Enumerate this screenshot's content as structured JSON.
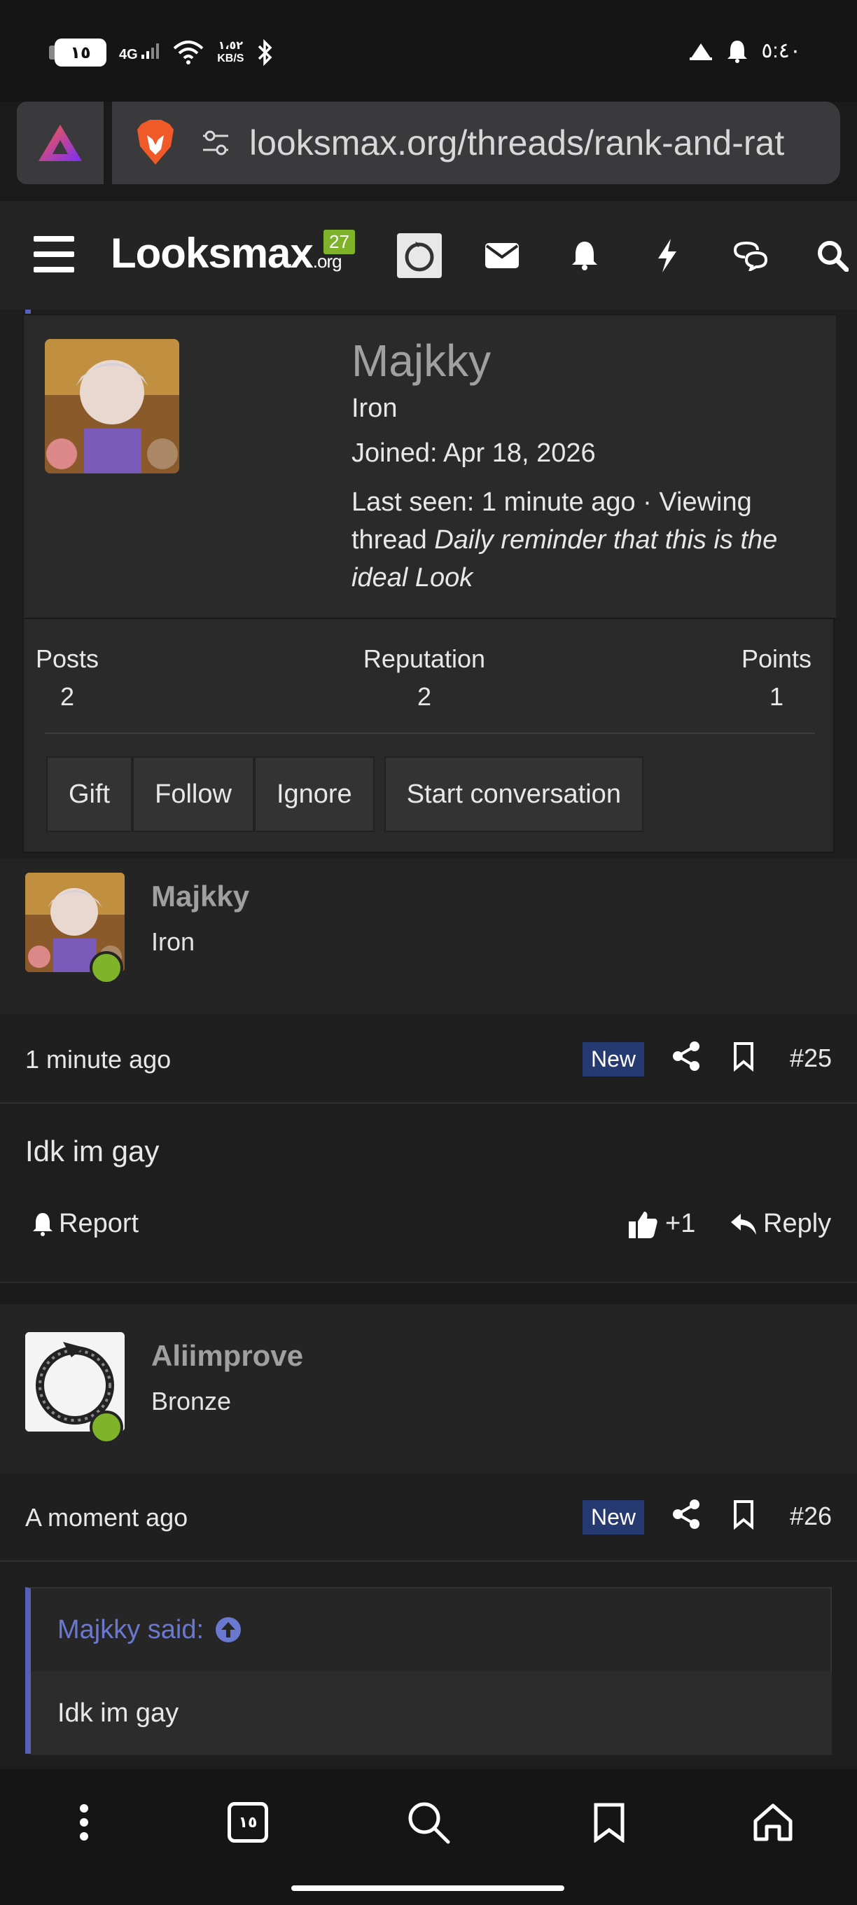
{
  "status_bar": {
    "battery": "١٥",
    "network": "4G",
    "speed_top": "١،٥٢",
    "speed_unit": "KB/S",
    "time": "٥:٤٠"
  },
  "browser": {
    "url": "looksmax.org/threads/rank-and-rat"
  },
  "site_header": {
    "logo_main": "Looksmax",
    "logo_suffix": ".org",
    "conversations_badge": "27"
  },
  "profile_popup": {
    "name": "Majkky",
    "rank": "Iron",
    "joined": "Joined: Apr 18, 2026",
    "last_seen_prefix": "Last seen: 1 minute ago · Viewing thread ",
    "last_seen_thread": "Daily reminder that this is the ideal Look",
    "stats": {
      "posts_label": "Posts",
      "posts_value": "2",
      "reputation_label": "Reputation",
      "reputation_value": "2",
      "points_label": "Points",
      "points_value": "1"
    },
    "actions": {
      "gift": "Gift",
      "follow": "Follow",
      "ignore": "Ignore",
      "start_conversation": "Start conversation"
    }
  },
  "posts": [
    {
      "username": "Majkky",
      "rank": "Iron",
      "time": "1 minute ago",
      "badge": "New",
      "number": "#25",
      "body": "Idk im gay",
      "report_label": "Report",
      "like_count": "+1",
      "reply_label": "Reply"
    },
    {
      "username": "Aliimprove",
      "rank": "Bronze",
      "time": "A moment ago",
      "badge": "New",
      "number": "#26",
      "quote_author": "Majkky said:",
      "quote_body": "Idk im gay"
    }
  ],
  "bottom_nav": {
    "tab_count": "١٥"
  }
}
